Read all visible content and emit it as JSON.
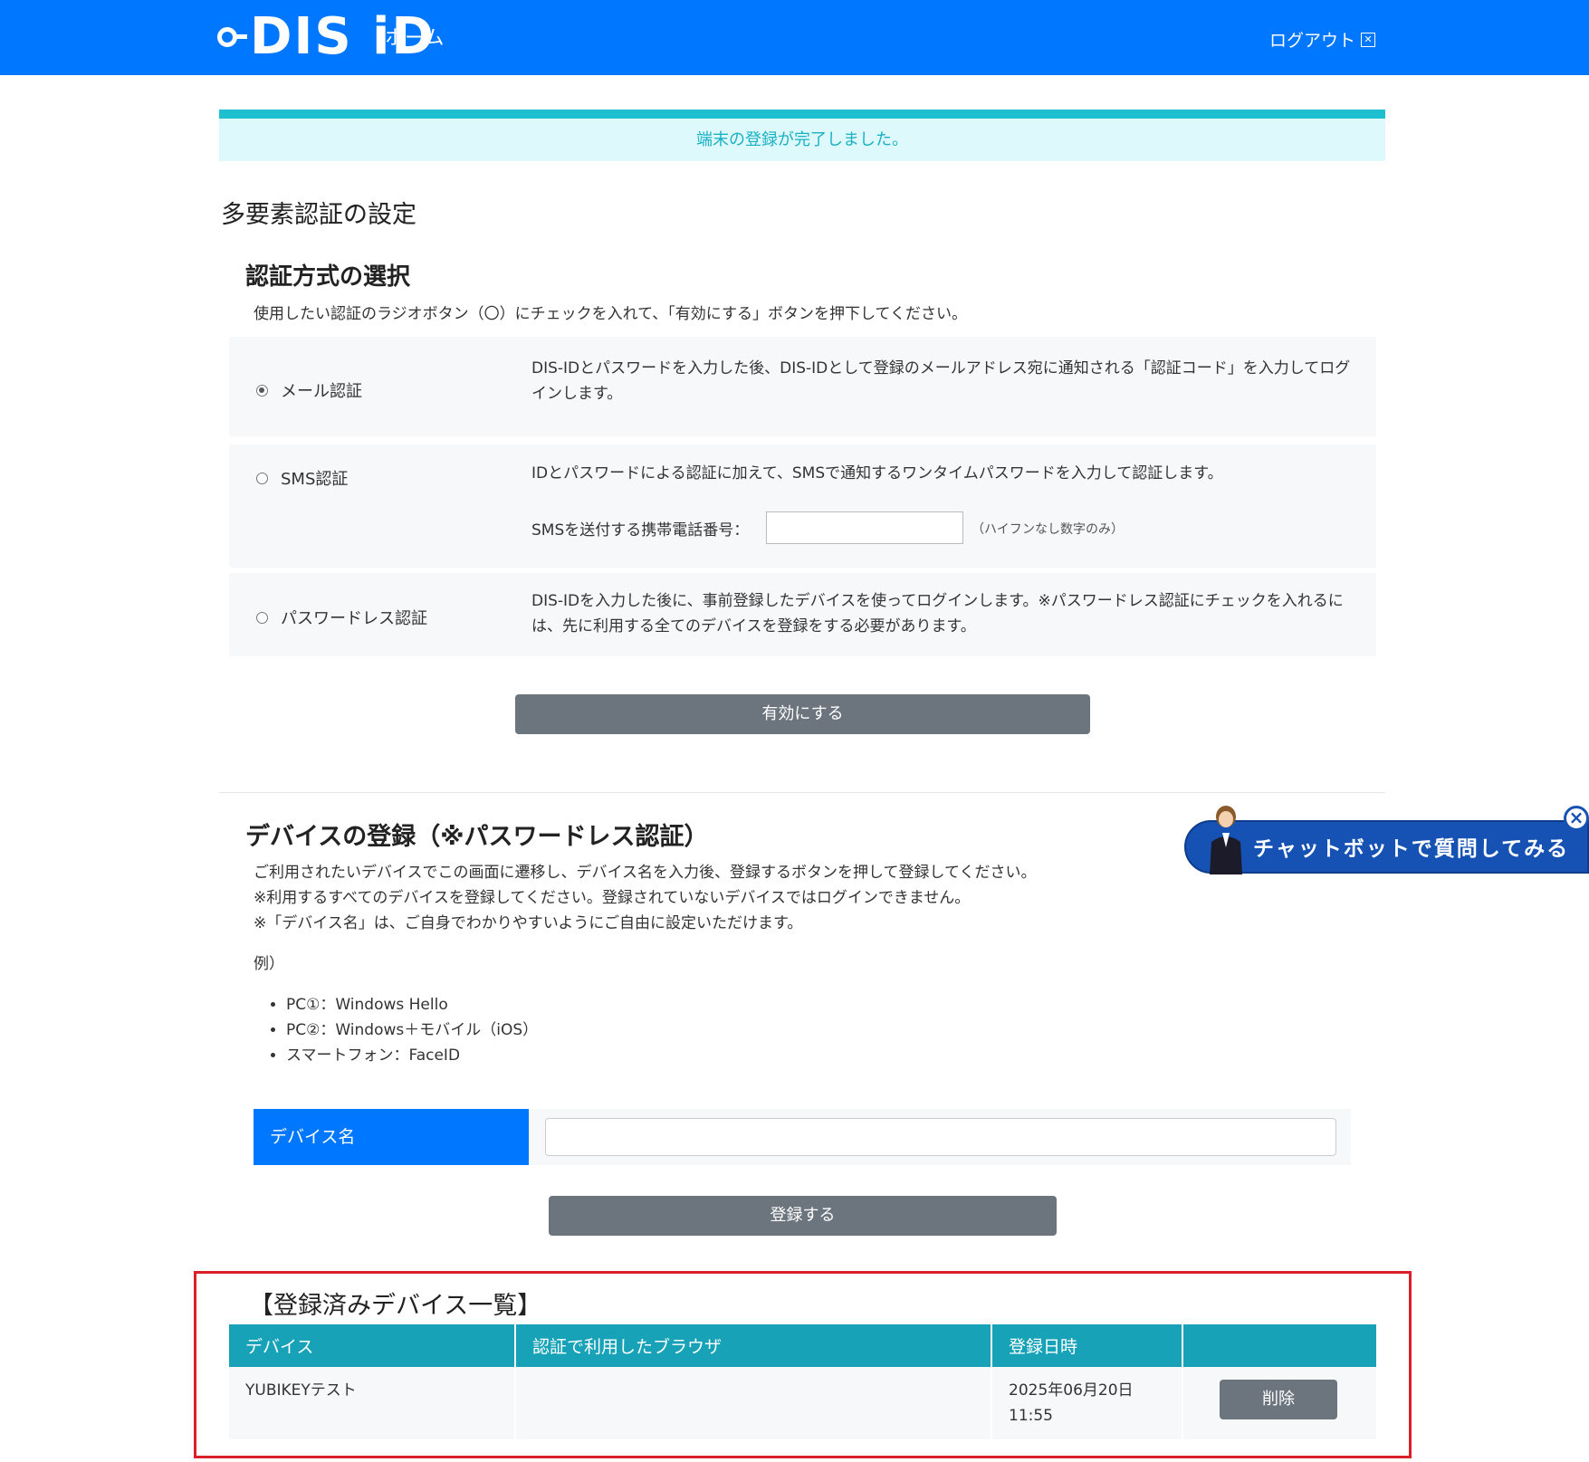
{
  "header": {
    "logo_text": "DIS iD",
    "home_label": "ホーム",
    "logout_label": "ログアウト"
  },
  "alert": {
    "message": "端末の登録が完了しました。"
  },
  "mfa": {
    "title": "多要素認証の設定",
    "method_title": "認証方式の選択",
    "method_desc": "使用したい認証のラジオボタン（〇）にチェックを入れて、「有効にする」ボタンを押下してください。",
    "options": [
      {
        "label": "メール認証",
        "checked": true,
        "desc": "DIS-IDとパスワードを入力した後、DIS-IDとして登録のメールアドレス宛に通知される「認証コード」を入力してログインします。"
      },
      {
        "label": "SMS認証",
        "checked": false,
        "desc": "IDとパスワードによる認証に加えて、SMSで通知するワンタイムパスワードを入力して認証します。"
      },
      {
        "label": "パスワードレス認証",
        "checked": false,
        "desc": "DIS-IDを入力した後に、事前登録したデバイスを使ってログインします。※パスワードレス認証にチェックを入れるには、先に利用する全てのデバイスを登録をする必要があります。"
      }
    ],
    "sms_phone_label": "SMSを送付する携帯電話番号：",
    "sms_phone_value": "",
    "sms_hint": "（ハイフンなし数字のみ）",
    "enable_button": "有効にする"
  },
  "device_reg": {
    "title": "デバイスの登録（※パスワードレス認証）",
    "desc_lines": [
      "ご利用されたいデバイスでこの画面に遷移し、デバイス名を入力後、登録するボタンを押して登録してください。",
      "※利用するすべてのデバイスを登録してください。登録されていないデバイスではログインできません。",
      "※「デバイス名」は、ご自身でわかりやすいようにご自由に設定いただけます。"
    ],
    "example_label": "例）",
    "examples": [
      "PC①：Windows Hello",
      "PC②：Windows＋モバイル（iOS）",
      "スマートフォン：FaceID"
    ],
    "device_name_label": "デバイス名",
    "device_name_value": "",
    "register_button": "登録する"
  },
  "chatbot": {
    "label": "チャットボットで質問してみる"
  },
  "registered": {
    "title": "【登録済みデバイス一覧】",
    "columns": [
      "デバイス",
      "認証で利用したブラウザ",
      "登録日時",
      ""
    ],
    "rows": [
      {
        "device": "YUBIKEYテスト",
        "browser": "",
        "date": "2025年06月20日",
        "time": "11:55",
        "action": "削除"
      }
    ]
  },
  "colors": {
    "header_bg": "#0077ff",
    "alert_bg": "#ddf9fc",
    "alert_accent": "#1ebfce",
    "table_header": "#17a2b8",
    "button_gray": "#6c757d",
    "highlight_border": "#d9202a"
  }
}
